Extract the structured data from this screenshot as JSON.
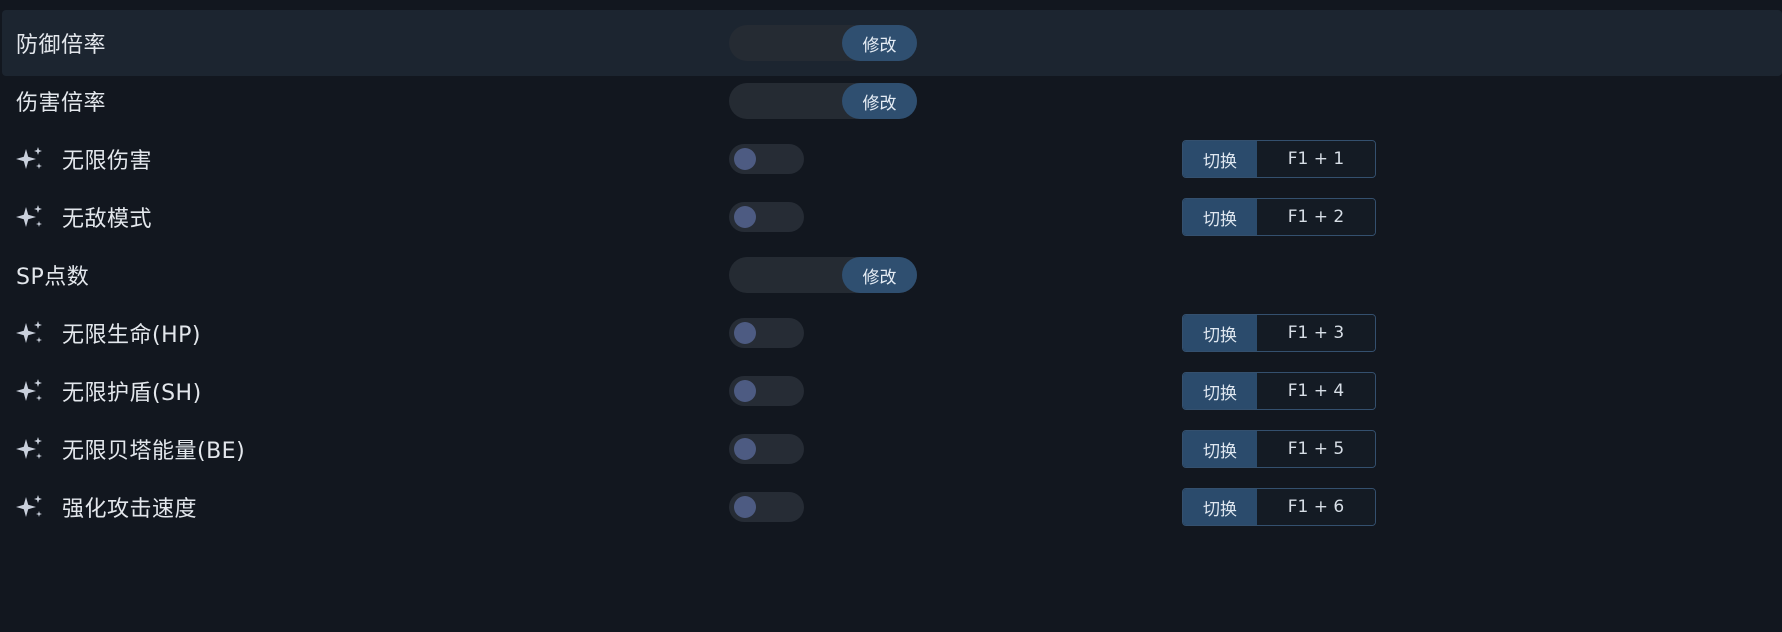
{
  "rows": [
    {
      "label": "防御倍率",
      "control": "modify",
      "button": "修改"
    },
    {
      "label": "伤害倍率",
      "control": "modify",
      "button": "修改"
    },
    {
      "label": "无限伤害",
      "control": "toggle",
      "icon": "sparkle-icon",
      "switch_label": "切换",
      "keys": "F1 + 1"
    },
    {
      "label": "无敌模式",
      "control": "toggle",
      "icon": "sparkle-icon",
      "switch_label": "切换",
      "keys": "F1 + 2"
    },
    {
      "label": "SP点数",
      "control": "modify",
      "button": "修改"
    },
    {
      "label": "无限生命(HP)",
      "control": "toggle",
      "icon": "sparkle-icon",
      "switch_label": "切换",
      "keys": "F1 + 3"
    },
    {
      "label": "无限护盾(SH)",
      "control": "toggle",
      "icon": "sparkle-icon",
      "switch_label": "切换",
      "keys": "F1 + 4"
    },
    {
      "label": "无限贝塔能量(BE)",
      "control": "toggle",
      "icon": "sparkle-icon",
      "switch_label": "切换",
      "keys": "F1 + 5"
    },
    {
      "label": "强化攻击速度",
      "control": "toggle",
      "icon": "sparkle-icon",
      "switch_label": "切换",
      "keys": "F1 + 6"
    }
  ],
  "toggles_on": [
    false,
    false,
    false,
    false,
    false,
    false,
    false
  ],
  "colors": {
    "background": "#12171f",
    "row_highlight": "#1c2530",
    "accent": "#2f4f70",
    "toggle_knob": "#4d5b82",
    "text": "#e3e7ec"
  }
}
